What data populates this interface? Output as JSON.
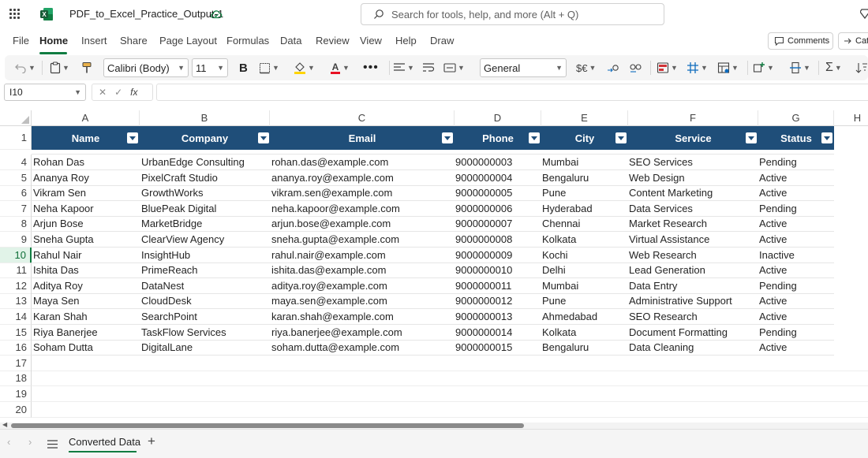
{
  "app": {
    "doc_title": "PDF_to_Excel_Practice_Output-1",
    "search_placeholder": "Search for tools, help, and more (Alt + Q)"
  },
  "menu": {
    "tabs": [
      "File",
      "Home",
      "Insert",
      "Share",
      "Page Layout",
      "Formulas",
      "Data",
      "Review",
      "View",
      "Help",
      "Draw"
    ],
    "active": "Home",
    "comments_label": "Comments",
    "cat_label": "Cat"
  },
  "ribbon": {
    "font_name": "Calibri (Body)",
    "font_size": "11",
    "bold_label": "B",
    "number_format": "General",
    "currency_label": "$€"
  },
  "formula_bar": {
    "name_box": "I10",
    "fx_label": "fx",
    "formula": ""
  },
  "columns": [
    "A",
    "B",
    "C",
    "D",
    "E",
    "F",
    "G",
    "H"
  ],
  "table_headers": [
    "Name",
    "Company",
    "Email",
    "Phone",
    "City",
    "Service",
    "Status"
  ],
  "rows": [
    {
      "row": "4",
      "cells": [
        "Rohan Das",
        "UrbanEdge Consulting",
        "rohan.das@example.com",
        "9000000003",
        "Mumbai",
        "SEO Services",
        "Pending"
      ]
    },
    {
      "row": "5",
      "cells": [
        "Ananya Roy",
        "PixelCraft Studio",
        "ananya.roy@example.com",
        "9000000004",
        "Bengaluru",
        "Web Design",
        "Active"
      ]
    },
    {
      "row": "6",
      "cells": [
        "Vikram Sen",
        "GrowthWorks",
        "vikram.sen@example.com",
        "9000000005",
        "Pune",
        "Content Marketing",
        "Active"
      ]
    },
    {
      "row": "7",
      "cells": [
        "Neha Kapoor",
        "BluePeak Digital",
        "neha.kapoor@example.com",
        "9000000006",
        "Hyderabad",
        "Data Services",
        "Pending"
      ]
    },
    {
      "row": "8",
      "cells": [
        "Arjun Bose",
        "MarketBridge",
        "arjun.bose@example.com",
        "9000000007",
        "Chennai",
        "Market Research",
        "Active"
      ]
    },
    {
      "row": "9",
      "cells": [
        "Sneha Gupta",
        "ClearView Agency",
        "sneha.gupta@example.com",
        "9000000008",
        "Kolkata",
        "Virtual Assistance",
        "Active"
      ]
    },
    {
      "row": "10",
      "cells": [
        "Rahul Nair",
        "InsightHub",
        "rahul.nair@example.com",
        "9000000009",
        "Kochi",
        "Web Research",
        "Inactive"
      ]
    },
    {
      "row": "11",
      "cells": [
        "Ishita Das",
        "PrimeReach",
        "ishita.das@example.com",
        "9000000010",
        "Delhi",
        "Lead Generation",
        "Active"
      ]
    },
    {
      "row": "12",
      "cells": [
        "Aditya Roy",
        "DataNest",
        "aditya.roy@example.com",
        "9000000011",
        "Mumbai",
        "Data Entry",
        "Pending"
      ]
    },
    {
      "row": "13",
      "cells": [
        "Maya Sen",
        "CloudDesk",
        "maya.sen@example.com",
        "9000000012",
        "Pune",
        "Administrative Support",
        "Active"
      ]
    },
    {
      "row": "14",
      "cells": [
        "Karan Shah",
        "SearchPoint",
        "karan.shah@example.com",
        "9000000013",
        "Ahmedabad",
        "SEO Research",
        "Active"
      ]
    },
    {
      "row": "15",
      "cells": [
        "Riya Banerjee",
        "TaskFlow Services",
        "riya.banerjee@example.com",
        "9000000014",
        "Kolkata",
        "Document Formatting",
        "Pending"
      ]
    },
    {
      "row": "16",
      "cells": [
        "Soham Dutta",
        "DigitalLane",
        "soham.dutta@example.com",
        "9000000015",
        "Bengaluru",
        "Data Cleaning",
        "Active"
      ]
    }
  ],
  "header_row_number": "1",
  "empty_rows": [
    "17",
    "18",
    "19",
    "20"
  ],
  "active_row": "10",
  "sheet": {
    "tab_label": "Converted Data"
  },
  "colors": {
    "accent": "#107c41",
    "table_header": "#1f4e79"
  }
}
